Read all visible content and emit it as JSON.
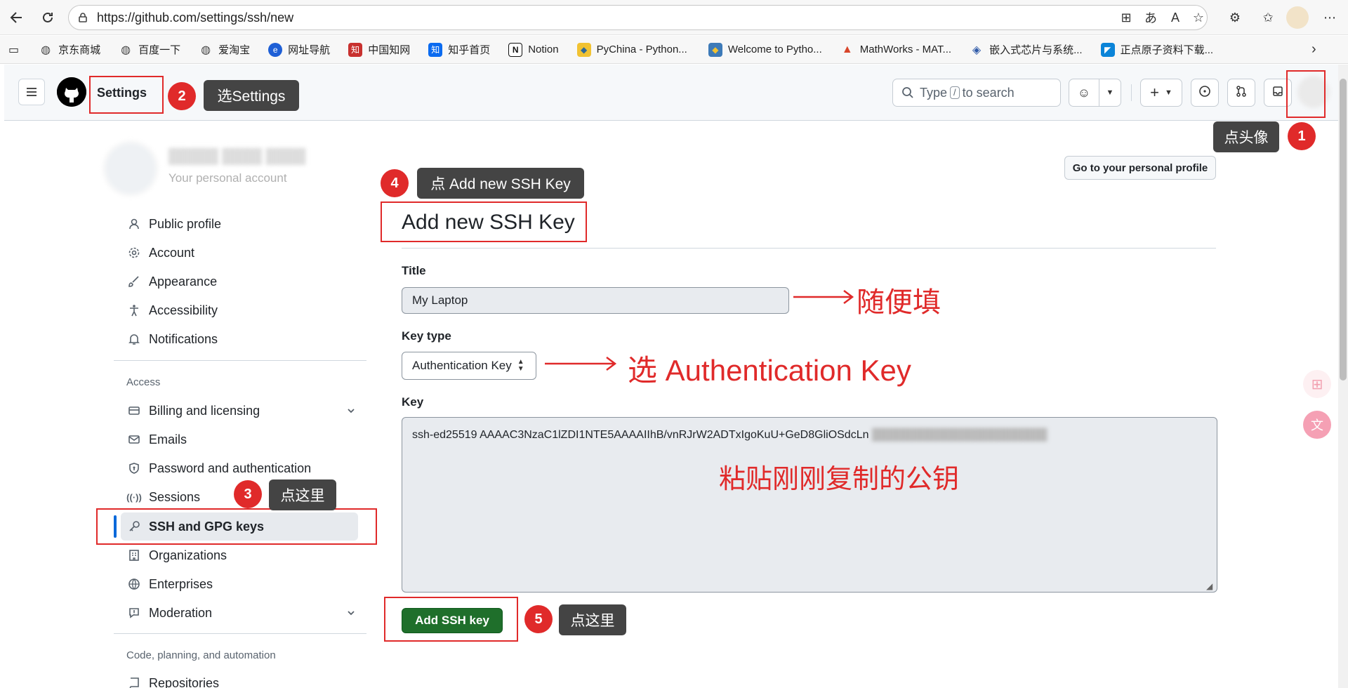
{
  "browser": {
    "url": "https://github.com/settings/ssh/new",
    "bookmarks": [
      "京东商城",
      "百度一下",
      "爱淘宝",
      "网址导航",
      "中国知网",
      "知乎首页",
      "Notion",
      "PyChina - Python...",
      "Welcome to Pytho...",
      "MathWorks - MAT...",
      "嵌入式芯片与系统...",
      "正点原子资料下载..."
    ]
  },
  "header": {
    "settings_label": "Settings",
    "search_prefix": "Type",
    "search_key": "/",
    "search_suffix": "to search"
  },
  "sidebar": {
    "account_subtitle": "Your personal account",
    "items_top": [
      "Public profile",
      "Account",
      "Appearance",
      "Accessibility",
      "Notifications"
    ],
    "access_heading": "Access",
    "items_access": [
      "Billing and licensing",
      "Emails",
      "Password and authentication",
      "Sessions",
      "SSH and GPG keys",
      "Organizations",
      "Enterprises",
      "Moderation"
    ],
    "code_heading": "Code, planning, and automation",
    "items_code": [
      "Repositories"
    ]
  },
  "main": {
    "profile_button": "Go to your personal profile",
    "title": "Add new SSH Key",
    "title_label": "Title",
    "title_value": "My Laptop",
    "key_type_label": "Key type",
    "key_type_value": "Authentication Key",
    "key_label": "Key",
    "key_value": "ssh-ed25519 AAAAC3NzaC1lZDI1NTE5AAAAIIhB/vnRJrW2ADTxIgoKuU+GeD8GliOSdcLn",
    "submit": "Add SSH key"
  },
  "annotations": {
    "n1": "1",
    "t1": "点头像",
    "n2": "2",
    "t2": "选Settings",
    "n3": "3",
    "t3": "点这里",
    "n4": "4",
    "t4": "点 Add new SSH Key",
    "n5": "5",
    "t5": "点这里",
    "note_title": "随便填",
    "note_keytype": "选 Authentication Key",
    "note_key": "粘贴刚刚复制的公钥"
  },
  "colors": {
    "accent_red": "#e02a2a",
    "primary_green": "#1f6f2b",
    "active_blue": "#0969da"
  }
}
